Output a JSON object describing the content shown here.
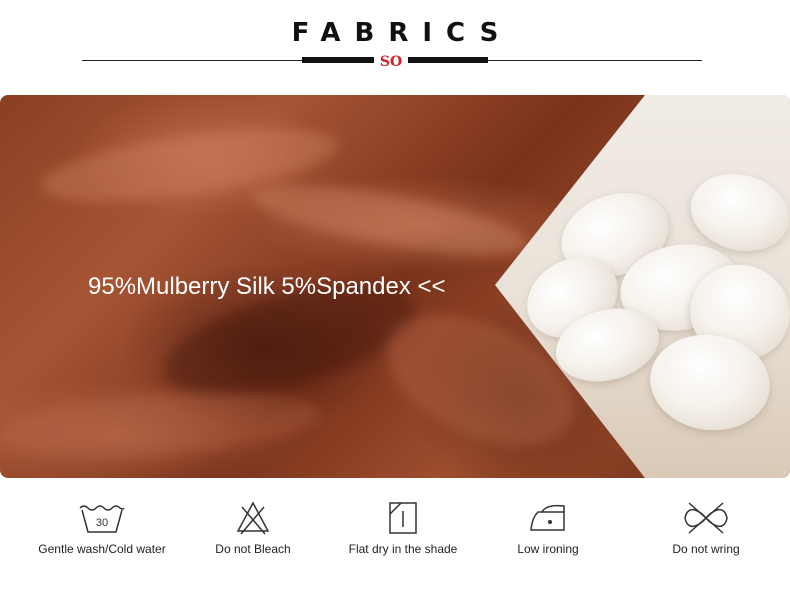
{
  "header": {
    "title": "FABRICS",
    "logo_text": "SO"
  },
  "banner": {
    "text": "95%Mulberry Silk 5%Spandex << ",
    "silk_color": "#8a3f22",
    "cocoon_color": "#f6f2ec"
  },
  "care": {
    "items": [
      {
        "icon": "wash-30-icon",
        "label": "Gentle wash/Cold water",
        "badge": "30"
      },
      {
        "icon": "no-bleach-icon",
        "label": "Do not Bleach"
      },
      {
        "icon": "flat-dry-shade-icon",
        "label": "Flat dry in the shade"
      },
      {
        "icon": "low-iron-icon",
        "label": "Low ironing"
      },
      {
        "icon": "no-wring-icon",
        "label": "Do not wring"
      }
    ]
  }
}
